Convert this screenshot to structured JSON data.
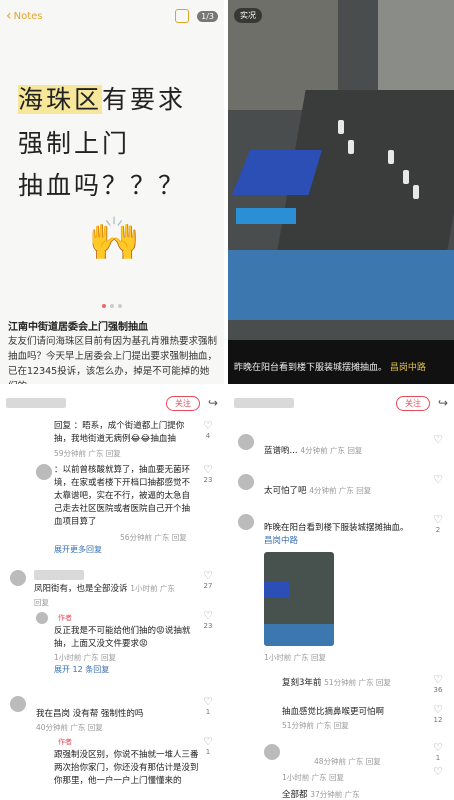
{
  "notes": {
    "back_label": "Notes",
    "page_indicator": "1/3",
    "line1_hl": "海珠区",
    "line1_rest": "有要求",
    "line2": "强制上门",
    "line3": "抽血吗？？？",
    "hands": "🙌",
    "title": "江南中街道居委会上门强制抽血",
    "body": "友友们请问海珠区目前有因为基孔肯雅热要求强制抽血吗？今天早上居委会上门提出要求强制抽血，已在12345投诉，该怎么办，掉是不可能掉的她们的"
  },
  "photo": {
    "tag": "实况",
    "caption": "昨晚在阳台看到楼下服装城摆摊抽血。",
    "location": "昌岗中路"
  },
  "left_comments": {
    "follow": "关注",
    "share": "↪",
    "c1": {
      "text": "回复 ：晤系，成个街道都上门提你抽，我地街道无病例😂😂抽血抽",
      "meta": "59分钟前 广东 回复",
      "likes": "4"
    },
    "c2": {
      "text": "：以前曾核酸就算了，抽血要无菌环境，在家或者楼下开档口抽都感觉不太靠谱吧，实在不行，被逼的太急自己走去社区医院或者医院自己开个抽血项目算了",
      "meta": "56分钟前 广东 回复",
      "likes": "23",
      "more": "展开更多回复"
    },
    "c3": {
      "text": "凤阳街有，也是全部没诉",
      "meta": "1小时前 广东 回复",
      "likes": "27"
    },
    "c4": {
      "author": "作者",
      "text": "反正我是不可能给他们抽的😡说抽就抽，上面又没文件要求😡",
      "meta": "1小时前 广东 回复",
      "likes": "23",
      "more": "展开 12 条回复"
    },
    "c5": {
      "text": "我在昌岗 没有帮 强制性的吗",
      "meta": "40分钟前 广东 回复",
      "likes": "1"
    },
    "c6": {
      "author": "作者",
      "text": "跟强制没区别，你说不抽就一堆人三番两次抬你家门，你还没有那估计是没到你那里，他一户一户上门懂懂来的",
      "meta": "",
      "likes": "1"
    }
  },
  "right_comments": {
    "follow": "关注",
    "share": "↪",
    "c1": {
      "text": "蓝谱哟...",
      "meta": "4分钟前 广东 回复",
      "likes": ""
    },
    "c2": {
      "text": "太可怕了吧",
      "meta": "4分钟前 广东 回复",
      "likes": ""
    },
    "c3": {
      "text": "昨晚在阳台看到楼下服装城摆摊抽血。",
      "loc": "昌岗中路",
      "meta": "1小时前 广东 回复",
      "likes": "2"
    },
    "c4": {
      "text": "复刻3年前",
      "meta": "51分钟前 广东 回复",
      "likes": "36"
    },
    "c5": {
      "text": "抽血感觉比摘鼻喉更可怕啊",
      "meta": "51分钟前 广东 回复",
      "likes": "12"
    },
    "c6": {
      "text": "",
      "meta": "48分钟前 广东 回复",
      "likes": "1"
    },
    "c7": {
      "text": "",
      "meta": "1小时前 广东 回复",
      "likes": ""
    },
    "c8": {
      "text": "全部都",
      "meta": "37分钟前 广东",
      "likes": ""
    }
  }
}
